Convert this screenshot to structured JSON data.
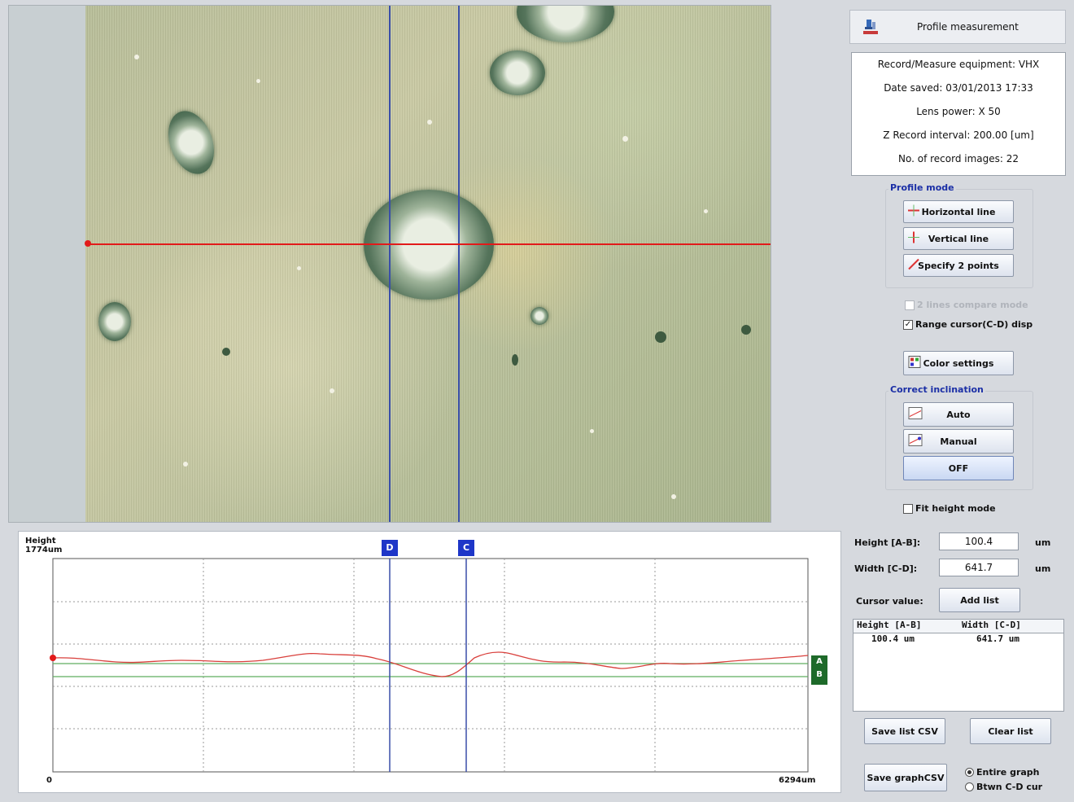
{
  "header": {
    "title": "Profile measurement",
    "icon": "microscope-icon"
  },
  "info": {
    "equipment": "Record/Measure equipment: VHX",
    "date_saved": "Date saved: 03/01/2013 17:33",
    "lens_power": "Lens power: X 50",
    "z_interval": "Z Record interval: 200.00 [um]",
    "num_images": "No. of record images: 22"
  },
  "profile_mode": {
    "title": "Profile mode",
    "horizontal": "Horizontal line",
    "vertical": "Vertical line",
    "two_points": "Specify 2 points"
  },
  "options": {
    "two_lines": "2 lines compare mode",
    "range_cursor": "Range cursor(C-D) disp"
  },
  "color_settings": "Color settings",
  "correct_inclination": {
    "title": "Correct inclination",
    "auto": "Auto",
    "manual": "Manual",
    "off": "OFF"
  },
  "fit_height": "Fit height mode",
  "graph": {
    "y_label_top": "Height",
    "y_label_value": "1774um",
    "x_start": "0",
    "x_end": "6294um",
    "cursor_d": "D",
    "cursor_c": "C",
    "cursor_a": "A",
    "cursor_b": "B"
  },
  "measure": {
    "height_label": "Height [A-B]:",
    "height_value": "100.4",
    "height_unit": "um",
    "width_label": "Width [C-D]:",
    "width_value": "641.7",
    "width_unit": "um",
    "cursor_value_label": "Cursor value:",
    "add_list": "Add list"
  },
  "list": {
    "columns": [
      "Height [A-B]",
      "Width [C-D]"
    ],
    "rows": [
      [
        "100.4 um",
        "641.7 um"
      ]
    ]
  },
  "buttons": {
    "save_list_csv": "Save list CSV",
    "clear_list": "Clear list",
    "save_graph_csv": "Save graphCSV"
  },
  "radio": {
    "entire_graph": "Entire graph",
    "between_cd": "Btwn C-D cur"
  },
  "colors": {
    "profile_line": "#d9403c",
    "cursor_line": "#3a4fa8",
    "ab_line": "#5fae5f",
    "accent_title": "#1b2fa6"
  }
}
